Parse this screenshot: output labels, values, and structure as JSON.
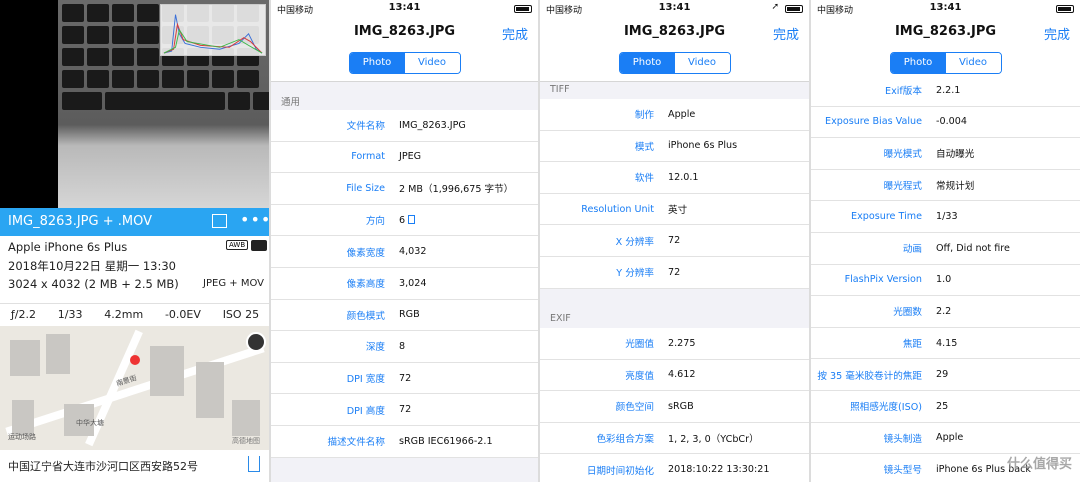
{
  "panel1": {
    "bar_title": "IMG_8263.JPG + .MOV",
    "more": "•••",
    "camera": "Apple iPhone 6s Plus",
    "awb": "AWB",
    "datetime": "2018年10月22日 星期一 13:30",
    "dimensions": "3024 x 4032 (2 MB + 2.5 MB)",
    "format": "JPEG + MOV",
    "exif": [
      "ƒ/2.2",
      "1/33",
      "4.2mm",
      "-0.0EV",
      "ISO 25"
    ],
    "map_labels": [
      "运动场路",
      "中华大塘",
      "高德地图",
      "南景街"
    ],
    "address": "中国辽宁省大连市沙河口区西安路52号"
  },
  "status": {
    "carrier": "中国移动",
    "time": "13:41"
  },
  "nav": {
    "title": "IMG_8263.JPG",
    "done": "完成",
    "seg_photo": "Photo",
    "seg_video": "Video"
  },
  "panel2": {
    "section": "通用",
    "rows": [
      {
        "k": "文件名称",
        "v": "IMG_8263.JPG"
      },
      {
        "k": "Format",
        "v": "JPEG"
      },
      {
        "k": "File Size",
        "v": "2 MB（1,996,675 字节）"
      },
      {
        "k": "方向",
        "v": "6"
      },
      {
        "k": "像素宽度",
        "v": "4,032"
      },
      {
        "k": "像素高度",
        "v": "3,024"
      },
      {
        "k": "颜色模式",
        "v": "RGB"
      },
      {
        "k": "深度",
        "v": "8"
      },
      {
        "k": "DPI 宽度",
        "v": "72"
      },
      {
        "k": "DPI 高度",
        "v": "72"
      },
      {
        "k": "描述文件名称",
        "v": "sRGB IEC61966-2.1"
      }
    ]
  },
  "panel3": {
    "section_tiff": "TIFF",
    "tiff_rows": [
      {
        "k": "制作",
        "v": "Apple"
      },
      {
        "k": "模式",
        "v": "iPhone 6s Plus"
      },
      {
        "k": "软件",
        "v": "12.0.1"
      },
      {
        "k": "Resolution Unit",
        "v": "英寸"
      },
      {
        "k": "X 分辨率",
        "v": "72"
      },
      {
        "k": "Y 分辨率",
        "v": "72"
      }
    ],
    "section_exif": "EXIF",
    "exif_rows": [
      {
        "k": "光圈值",
        "v": "2.275"
      },
      {
        "k": "亮度值",
        "v": "4.612"
      },
      {
        "k": "颜色空间",
        "v": "sRGB"
      },
      {
        "k": "色彩组合方案",
        "v": "1, 2, 3, 0（YCbCr）"
      },
      {
        "k": "日期时间初始化",
        "v": "2018:10:22 13:30:21"
      }
    ]
  },
  "panel4": {
    "rows": [
      {
        "k": "Exif版本",
        "v": "2.2.1"
      },
      {
        "k": "Exposure Bias Value",
        "v": "-0.004"
      },
      {
        "k": "曝光模式",
        "v": "自动曝光"
      },
      {
        "k": "曝光程式",
        "v": "常规计划"
      },
      {
        "k": "Exposure Time",
        "v": "1/33"
      },
      {
        "k": "动画",
        "v": "Off, Did not fire"
      },
      {
        "k": "FlashPix Version",
        "v": "1.0"
      },
      {
        "k": "光圈数",
        "v": "2.2"
      },
      {
        "k": "焦距",
        "v": "4.15"
      },
      {
        "k": "按 35 毫米胶卷计的焦距",
        "v": "29"
      },
      {
        "k": "照相感光度(ISO)",
        "v": "25"
      },
      {
        "k": "镜头制造",
        "v": "Apple"
      },
      {
        "k": "镜头型号",
        "v": "iPhone 6s Plus back"
      }
    ],
    "watermark": "什么值得买"
  }
}
